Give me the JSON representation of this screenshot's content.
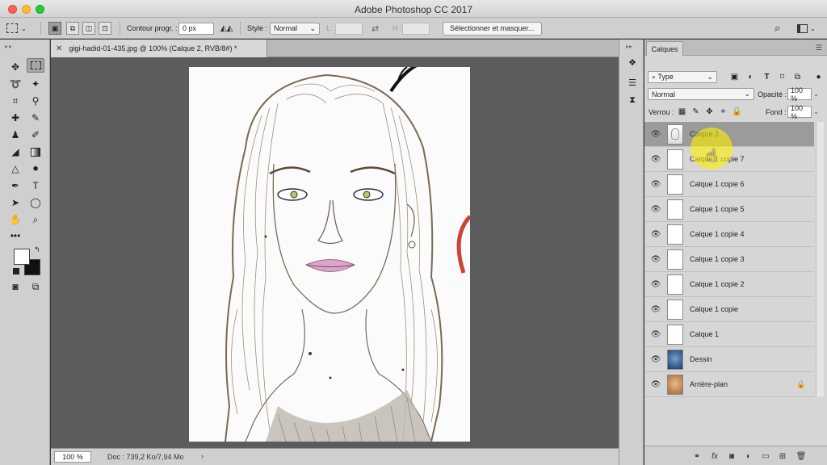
{
  "app": {
    "title": "Adobe Photoshop CC 2017"
  },
  "options": {
    "feather_label": "Contour progr. :",
    "feather_value": "0 px",
    "style_label": "Style :",
    "style_value": "Normal",
    "width_label": "L :",
    "height_label": "H :",
    "select_mask_label": "Sélectionner et masquer..."
  },
  "document": {
    "tab_title": "gigi-hadid-01-435.jpg @ 100% (Calque 2, RVB/8#) *",
    "zoom": "100 %",
    "doc_info": "Doc : 739,2 Ko/7,94 Mo"
  },
  "layers_panel": {
    "tab_label": "Calques",
    "kind_filter": "Type",
    "blend_mode": "Normal",
    "opacity_label": "Opacité :",
    "opacity_value": "100 %",
    "lock_label": "Verrou :",
    "fill_label": "Fond :",
    "fill_value": "100 %",
    "layers": [
      {
        "name": "Calque 2"
      },
      {
        "name": "Calque 1 copie 7"
      },
      {
        "name": "Calque 1 copie 6"
      },
      {
        "name": "Calque 1 copie 5"
      },
      {
        "name": "Calque 1 copie 4"
      },
      {
        "name": "Calque 1 copie 3"
      },
      {
        "name": "Calque 1 copie 2"
      },
      {
        "name": "Calque 1 copie"
      },
      {
        "name": "Calque 1"
      },
      {
        "name": "Dessin"
      },
      {
        "name": "Arrière-plan"
      }
    ],
    "footer_fx": "fx"
  },
  "colors": {
    "foreground": "#ffffff",
    "background": "#111111",
    "selected_layer": "#9b9b9b",
    "highlight": "#fff000"
  }
}
